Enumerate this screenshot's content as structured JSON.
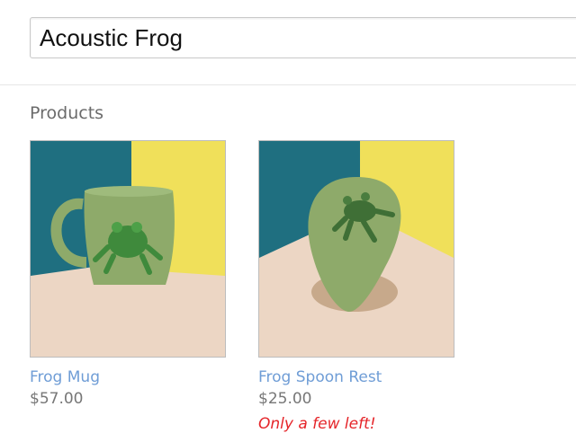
{
  "search": {
    "value": "Acoustic Frog"
  },
  "products_section": {
    "title": "Products"
  },
  "products": [
    {
      "name": "Frog Mug",
      "price": "$57.00",
      "stock_note": ""
    },
    {
      "name": "Frog Spoon Rest",
      "price": "$25.00",
      "stock_note": "Only a few left!"
    }
  ],
  "colors": {
    "link": "#6f9dd6",
    "price": "#777777",
    "stock_warning": "#e5252a",
    "photo_teal": "#1f6f80",
    "photo_yellow": "#f0e05a",
    "photo_counter": "#ecd6c4",
    "pottery_green": "#8eaa6a"
  }
}
